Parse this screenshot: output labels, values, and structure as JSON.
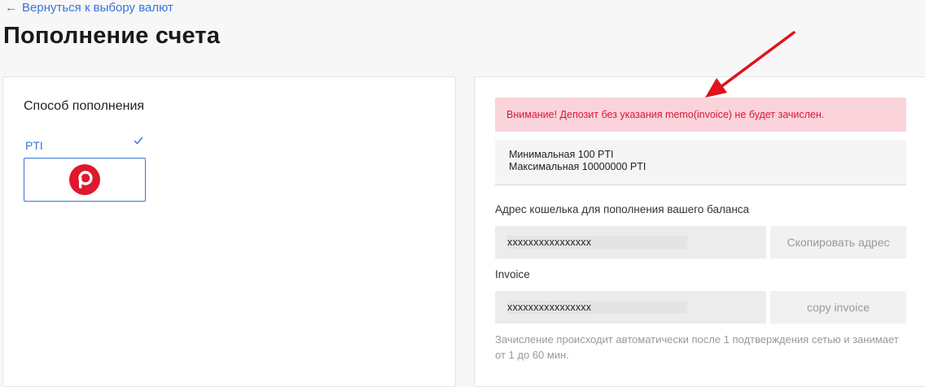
{
  "nav": {
    "back_label": "Вернуться к выбору валют"
  },
  "page": {
    "title": "Пополнение счета"
  },
  "method": {
    "title": "Способ пополнения",
    "selected_name": "PTI",
    "logo_color": "#e0182d"
  },
  "deposit": {
    "warning": "Внимание! Депозит без указания memo(invoice) не будет зачислен.",
    "min_limit": "Минимальная 100 PTI",
    "max_limit": "Максимальная 10000000 PTI",
    "wallet_label": "Адрес кошелька для пополнения вашего баланса",
    "wallet_value": "xxxxxxxxxxxxxxxx",
    "copy_address_label": "Скопировать адрес",
    "invoice_label": "Invoice",
    "invoice_value": "xxxxxxxxxxxxxxxx",
    "copy_invoice_label": "copy invoice",
    "note": "Зачисление происходит автоматически после 1 подтверждения сетью и занимает от 1 до 60 мин."
  },
  "colors": {
    "accent": "#3a74d6",
    "warning_bg": "#fad4da",
    "warning_text": "#d8163a",
    "annotation_arrow": "#e0121a"
  }
}
